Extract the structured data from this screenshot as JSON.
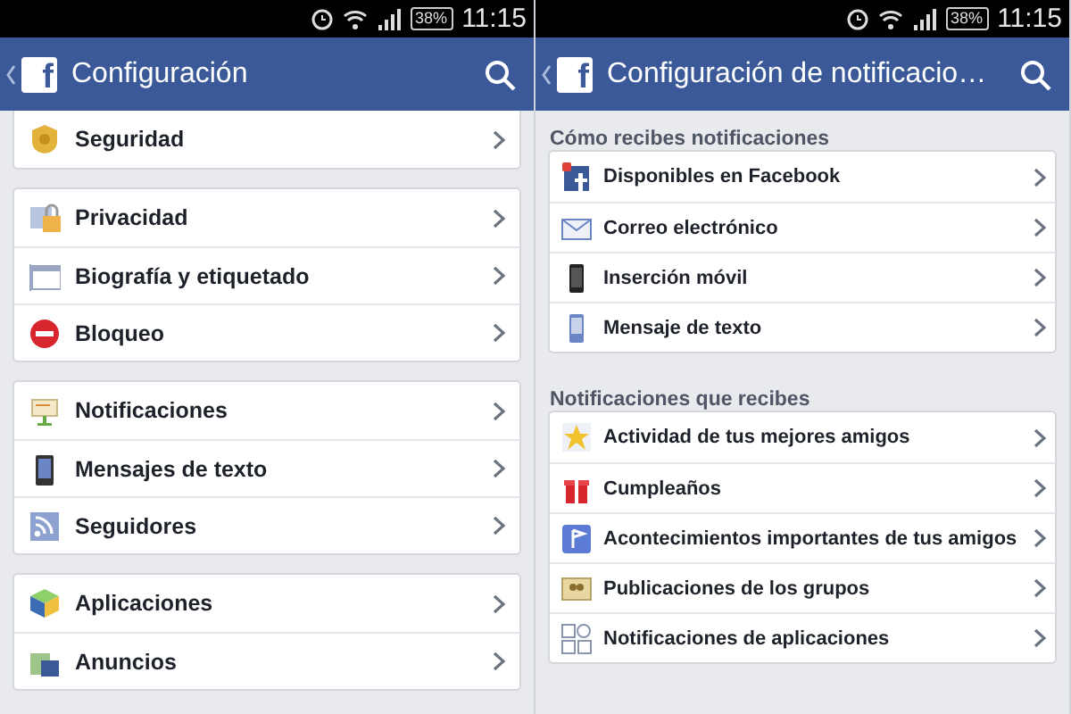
{
  "screens": [
    {
      "status_bar": {
        "battery": "38%",
        "time": "11:15"
      },
      "header": {
        "logo": "f",
        "title": "Configuración"
      },
      "groups": [
        {
          "cut_top": true,
          "items": [
            {
              "label": "Seguridad"
            }
          ]
        },
        {
          "cut_top": false,
          "items": [
            {
              "label": "Privacidad"
            },
            {
              "label": "Biografía y etiquetado"
            },
            {
              "label": "Bloqueo"
            }
          ]
        },
        {
          "cut_top": false,
          "items": [
            {
              "label": "Notificaciones"
            },
            {
              "label": "Mensajes de texto"
            },
            {
              "label": "Seguidores"
            }
          ]
        },
        {
          "cut_top": false,
          "items": [
            {
              "label": "Aplicaciones"
            },
            {
              "label": "Anuncios"
            }
          ]
        }
      ]
    },
    {
      "status_bar": {
        "battery": "38%",
        "time": "11:15"
      },
      "header": {
        "logo": "f",
        "title": "Configuración de notificacio…"
      },
      "groups": [
        {
          "cut_top": false,
          "heading": "Cómo recibes notificaciones",
          "items": [
            {
              "label": "Disponibles en Facebook"
            },
            {
              "label": "Correo electrónico"
            },
            {
              "label": "Inserción móvil"
            },
            {
              "label": "Mensaje de texto"
            }
          ]
        },
        {
          "cut_top": false,
          "heading": "Notificaciones que recibes",
          "items": [
            {
              "label": "Actividad de tus mejores amigos"
            },
            {
              "label": "Cumpleaños"
            },
            {
              "label": "Acontecimientos importantes de tus amigos"
            },
            {
              "label": "Publicaciones de los grupos"
            },
            {
              "label": "Notificaciones de aplicaciones"
            }
          ]
        }
      ]
    }
  ]
}
